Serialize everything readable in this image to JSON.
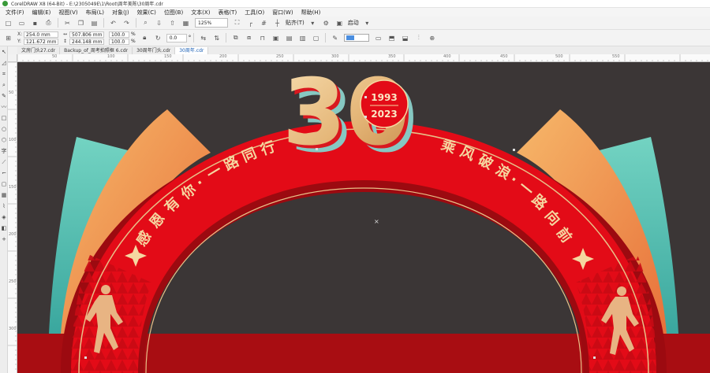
{
  "window": {
    "title": "CorelDRAW X8 (64-Bit) - E:\\2305049E\\1\\Root\\周年美陈\\30周年.cdr"
  },
  "menu": [
    "文件(F)",
    "编辑(E)",
    "视图(V)",
    "布局(L)",
    "对象(J)",
    "效果(C)",
    "位图(B)",
    "文本(X)",
    "表格(T)",
    "工具(O)",
    "窗口(W)",
    "帮助(H)"
  ],
  "toolbar": {
    "zoom": "125%",
    "snap_label": "贴齐(T)",
    "launch_label": "启动"
  },
  "properties": {
    "x_label": "X:",
    "x_value": "254.0 mm",
    "y_label": "Y:",
    "y_value": "121.672 mm",
    "w_value": "507.806 mm",
    "h_value": "244.148 mm",
    "scale_w": "100.0",
    "scale_h": "100.0",
    "pct": "%",
    "rotation": "0.0",
    "deg": "°"
  },
  "tabs": [
    "文房门头27.cdr",
    "Backup_of_周考拍照框 6.cdr",
    "30周年门头.cdr",
    "30周年.cdr"
  ],
  "active_tab": 3,
  "ruler_top": [
    "50",
    "100",
    "150",
    "200",
    "250",
    "300",
    "350",
    "400",
    "450",
    "500",
    "550"
  ],
  "ruler_left": [
    "50",
    "100",
    "150",
    "200",
    "250",
    "300"
  ],
  "artwork": {
    "big_number": "30",
    "year_top": "1993",
    "year_bottom": "2023",
    "left_slogan_chars": [
      "感",
      "恩",
      "有",
      "你",
      "·",
      "一",
      "路",
      "同",
      "行"
    ],
    "right_slogan_chars": [
      "乘",
      "风",
      "破",
      "浪",
      "·",
      "一",
      "路",
      "向",
      "前"
    ]
  },
  "colors": {
    "canvas_bg": "#3b3636",
    "arch_red": "#e30b17",
    "arch_dark_red": "#9c0a10",
    "gold": "#e8c088",
    "teal": "#5cc6b6",
    "orange": "#f2a45a",
    "floor_red": "#a80d12"
  }
}
